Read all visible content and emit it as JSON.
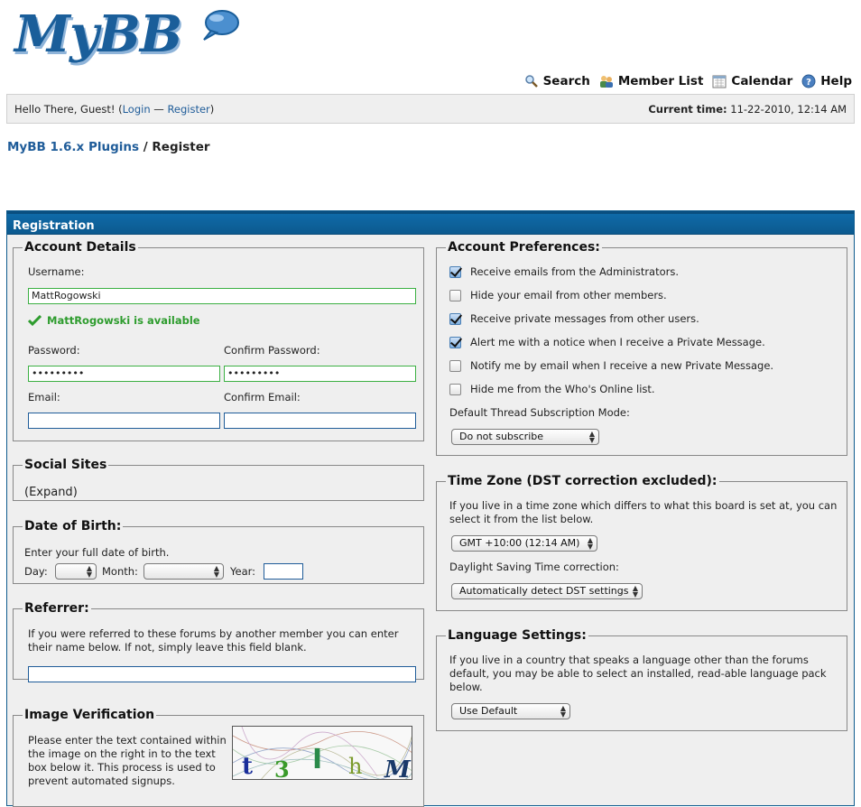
{
  "logo": {
    "text": "MyBB"
  },
  "nav": {
    "search": "Search",
    "member_list": "Member List",
    "calendar": "Calendar",
    "help": "Help"
  },
  "panel": {
    "greeting": "Hello There, Guest! (",
    "login": "Login",
    "sep": " — ",
    "register": "Register",
    "close": ")",
    "time_label": "Current time:",
    "time_value": "11-22-2010, 12:14 AM"
  },
  "breadcrumb": {
    "forum": "MyBB 1.6.x Plugins",
    "sep": " / ",
    "current": "Register"
  },
  "registration": {
    "title": "Registration",
    "account_details": {
      "legend": "Account Details",
      "username_label": "Username:",
      "username_value": "MattRogowski",
      "available_msg": "MattRogowski is available",
      "password_label": "Password:",
      "password_value": "•••••••••",
      "confirm_password_label": "Confirm Password:",
      "confirm_password_value": "•••••••••",
      "email_label": "Email:",
      "email_value": "",
      "confirm_email_label": "Confirm Email:",
      "confirm_email_value": ""
    },
    "social_sites": {
      "legend": "Social Sites",
      "expand": "(Expand)"
    },
    "dob": {
      "legend": "Date of Birth:",
      "hint": "Enter your full date of birth.",
      "day_label": "Day:",
      "month_label": "Month:",
      "year_label": "Year:"
    },
    "referrer": {
      "legend": "Referrer:",
      "text": "If you were referred to these forums by another member you can enter their name below. If not, simply leave this field blank."
    },
    "image_verification": {
      "legend": "Image Verification",
      "text": "Please enter the text contained within the image on the right in to the text box below it. This process is used to prevent automated signups."
    },
    "account_prefs": {
      "legend": "Account Preferences:",
      "options": [
        {
          "label": "Receive emails from the Administrators.",
          "checked": true
        },
        {
          "label": "Hide your email from other members.",
          "checked": false
        },
        {
          "label": "Receive private messages from other users.",
          "checked": true
        },
        {
          "label": "Alert me with a notice when I receive a Private Message.",
          "checked": true
        },
        {
          "label": "Notify me by email when I receive a new Private Message.",
          "checked": false
        },
        {
          "label": "Hide me from the Who's Online list.",
          "checked": false
        }
      ],
      "subscription_label": "Default Thread Subscription Mode:",
      "subscription_value": "Do not subscribe"
    },
    "timezone": {
      "legend": "Time Zone (DST correction excluded):",
      "text": "If you live in a time zone which differs to what this board is set at, you can select it from the list below.",
      "tz_value": "GMT +10:00 (12:14 AM)",
      "dst_label": "Daylight Saving Time correction:",
      "dst_value": "Automatically detect DST settings"
    },
    "language": {
      "legend": "Language Settings:",
      "text": "If you live in a country that speaks a language other than the forums default, you may be able to select an installed, read-able language pack below.",
      "value": "Use Default"
    }
  },
  "colors": {
    "link": "#1f5c99",
    "thead": "#0c5a8f",
    "available": "#2e9c2e"
  }
}
